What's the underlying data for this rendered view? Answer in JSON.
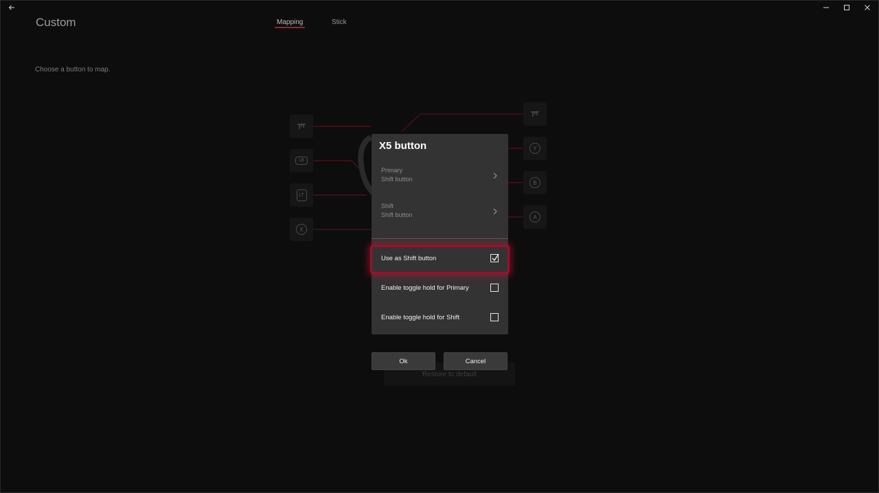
{
  "window": {
    "title": "Custom",
    "back_icon": "arrow-left-icon",
    "controls": [
      "minimize-icon",
      "maximize-icon",
      "close-icon"
    ]
  },
  "tabs": [
    {
      "label": "Mapping",
      "active": true
    },
    {
      "label": "Stick",
      "active": false
    }
  ],
  "hint": "Choose a button to map.",
  "background_map": {
    "left_buttons": [
      {
        "icon": "right-bumper-icon",
        "label": ""
      },
      {
        "icon": "left-bumper-icon",
        "label": "LB"
      },
      {
        "icon": "left-trigger-icon",
        "label": "LT"
      },
      {
        "icon": "x-button-icon",
        "label": "X"
      }
    ],
    "right_buttons": [
      {
        "icon": "trigger-icon",
        "label": ""
      },
      {
        "icon": "y-button-icon",
        "label": "Y"
      },
      {
        "icon": "b-button-icon",
        "label": "B"
      },
      {
        "icon": "a-button-icon",
        "label": "A"
      }
    ],
    "restore_label": "Restore to default",
    "accent": "#c2102f"
  },
  "dialog": {
    "title": "X5 button",
    "options": [
      {
        "title": "Primary",
        "value": "Shift button"
      },
      {
        "title": "Shift",
        "value": "Shift button"
      }
    ],
    "checks": [
      {
        "label": "Use as Shift button",
        "checked": true,
        "focused": true
      },
      {
        "label": "Enable toggle hold for Primary",
        "checked": false,
        "focused": false
      },
      {
        "label": "Enable toggle hold for Shift",
        "checked": false,
        "focused": false
      }
    ],
    "ok_label": "Ok",
    "cancel_label": "Cancel",
    "focus_color": "#9b1030"
  }
}
